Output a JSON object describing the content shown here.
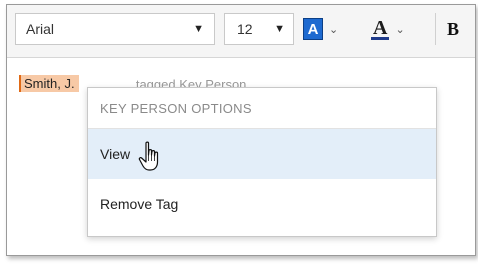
{
  "toolbar": {
    "font_name": "Arial",
    "font_size": "12",
    "highlight_letter": "A",
    "font_color_letter": "A",
    "bold_label": "B",
    "highlight_color": "#1e6ad0",
    "font_color_underline": "#1e3a8a"
  },
  "document": {
    "tagged_name": "Smith, J.",
    "faded_text": "...tagged Key Person..."
  },
  "context_menu": {
    "header": "KEY PERSON OPTIONS",
    "items": [
      {
        "label": "View",
        "state": "hover"
      },
      {
        "label": "Remove Tag",
        "state": "default"
      }
    ]
  },
  "colors": {
    "tag_highlight": "#f7c9a6",
    "tag_border": "#e06a16",
    "menu_hover": "#e3eef9"
  }
}
